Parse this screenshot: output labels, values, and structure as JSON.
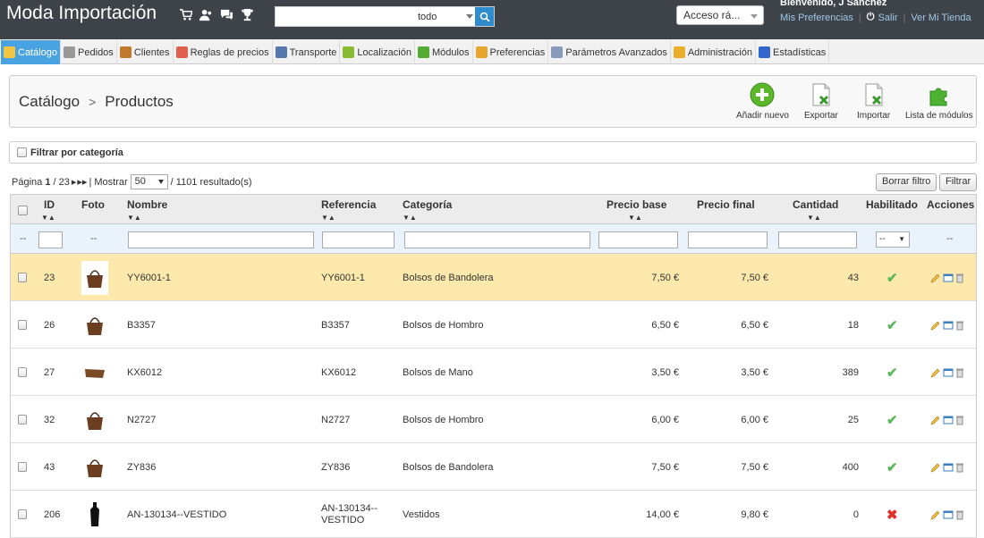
{
  "header": {
    "shop_name": "Moda Importación",
    "search_placeholder": "",
    "search_scope": "todo",
    "quick_access": "Acceso rá...",
    "welcome": "Bienvenido, J Sánchez",
    "links": {
      "preferences": "Mis Preferencias",
      "logout": "Salir",
      "view_store": "Ver Mi Tienda"
    }
  },
  "menu": [
    {
      "label": "Catálogo",
      "icon": "folder-icon",
      "color": "#f4c542"
    },
    {
      "label": "Pedidos",
      "icon": "cart-icon",
      "color": "#999999"
    },
    {
      "label": "Clientes",
      "icon": "users-icon",
      "color": "#c0792d"
    },
    {
      "label": "Reglas de precios",
      "icon": "price-rules-icon",
      "color": "#e06050"
    },
    {
      "label": "Transporte",
      "icon": "truck-icon",
      "color": "#5577aa"
    },
    {
      "label": "Localización",
      "icon": "globe-icon",
      "color": "#88bb33"
    },
    {
      "label": "Módulos",
      "icon": "puzzle-icon",
      "color": "#55aa33"
    },
    {
      "label": "Preferencias",
      "icon": "preferences-icon",
      "color": "#e7a630"
    },
    {
      "label": "Parámetros Avanzados",
      "icon": "wrench-icon",
      "color": "#8899bb"
    },
    {
      "label": "Administración",
      "icon": "key-icon",
      "color": "#e8b02a"
    },
    {
      "label": "Estadísticas",
      "icon": "bar-chart-icon",
      "color": "#3366cc"
    }
  ],
  "toolbar": {
    "breadcrumb_root": "Catálogo",
    "breadcrumb_current": "Productos",
    "add_new": "Añadir nuevo",
    "export": "Exportar",
    "import": "Importar",
    "modules_list": "Lista de módulos"
  },
  "filter_category": "Filtrar por categoría",
  "pagination": {
    "page_label": "Página",
    "page": "1",
    "total_pages": "/ 23",
    "show_label": "| Mostrar",
    "per_page": "50",
    "results": "/ 1101 resultado(s)",
    "reset_filter": "Borrar filtro",
    "filter": "Filtrar"
  },
  "table": {
    "columns": {
      "id": "ID",
      "photo": "Foto",
      "name": "Nombre",
      "reference": "Referencia",
      "category": "Categoría",
      "base_price": "Precio base",
      "final_price": "Precio final",
      "quantity": "Cantidad",
      "enabled": "Habilitado",
      "actions": "Acciones"
    },
    "filter_dash": "--",
    "enabled_filter": "--",
    "rows": [
      {
        "id": "23",
        "name": "YY6001-1",
        "reference": "YY6001-1",
        "category": "Bolsos de Bandolera",
        "base_price": "7,50 €",
        "final_price": "7,50 €",
        "quantity": "43",
        "enabled": true,
        "photo": "bag-photo"
      },
      {
        "id": "26",
        "name": "B3357",
        "reference": "B3357",
        "category": "Bolsos de Hombro",
        "base_price": "6,50 €",
        "final_price": "6,50 €",
        "quantity": "18",
        "enabled": true,
        "photo": "bag-photo"
      },
      {
        "id": "27",
        "name": "KX6012",
        "reference": "KX6012",
        "category": "Bolsos de Mano",
        "base_price": "3,50 €",
        "final_price": "3,50 €",
        "quantity": "389",
        "enabled": true,
        "photo": "clutch-photo"
      },
      {
        "id": "32",
        "name": "N2727",
        "reference": "N2727",
        "category": "Bolsos de Hombro",
        "base_price": "6,00 €",
        "final_price": "6,00 €",
        "quantity": "25",
        "enabled": true,
        "photo": "bag-photo"
      },
      {
        "id": "43",
        "name": "ZY836",
        "reference": "ZY836",
        "category": "Bolsos de Bandolera",
        "base_price": "7,50 €",
        "final_price": "7,50 €",
        "quantity": "400",
        "enabled": true,
        "photo": "bag-photo"
      },
      {
        "id": "206",
        "name": "AN-130134--VESTIDO",
        "reference": "AN-130134--VESTIDO",
        "reference_line1": "AN-130134--",
        "reference_line2": "VESTIDO",
        "category": "Vestidos",
        "base_price": "14,00 €",
        "final_price": "9,80 €",
        "quantity": "0",
        "enabled": false,
        "photo": "dress-photo"
      }
    ]
  },
  "colors": {
    "topbar": "#3d4349",
    "active_tab": "#49a3e0",
    "highlight_row": "#fce9ab",
    "enabled": "#5cb85c",
    "disabled": "#e0322c"
  }
}
